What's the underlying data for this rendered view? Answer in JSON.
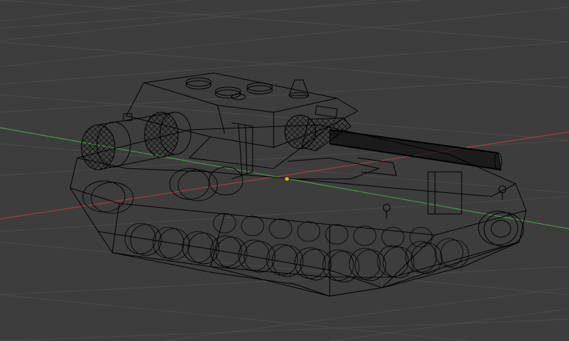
{
  "viewport": {
    "kind": "3d-viewport",
    "view": "perspective",
    "shading": "wireframe",
    "background_color": "#3d3d3d",
    "grid_color": "#4a4a4a",
    "x_axis_color": "#b03a3a",
    "y_axis_color": "#3fa03f",
    "wire_color": "#000000",
    "origin_color": "#f0b000"
  },
  "scene": {
    "object": {
      "subject": "tank",
      "selected": false
    },
    "show_grid": true,
    "show_axes": true,
    "object_origin_visible": true
  }
}
